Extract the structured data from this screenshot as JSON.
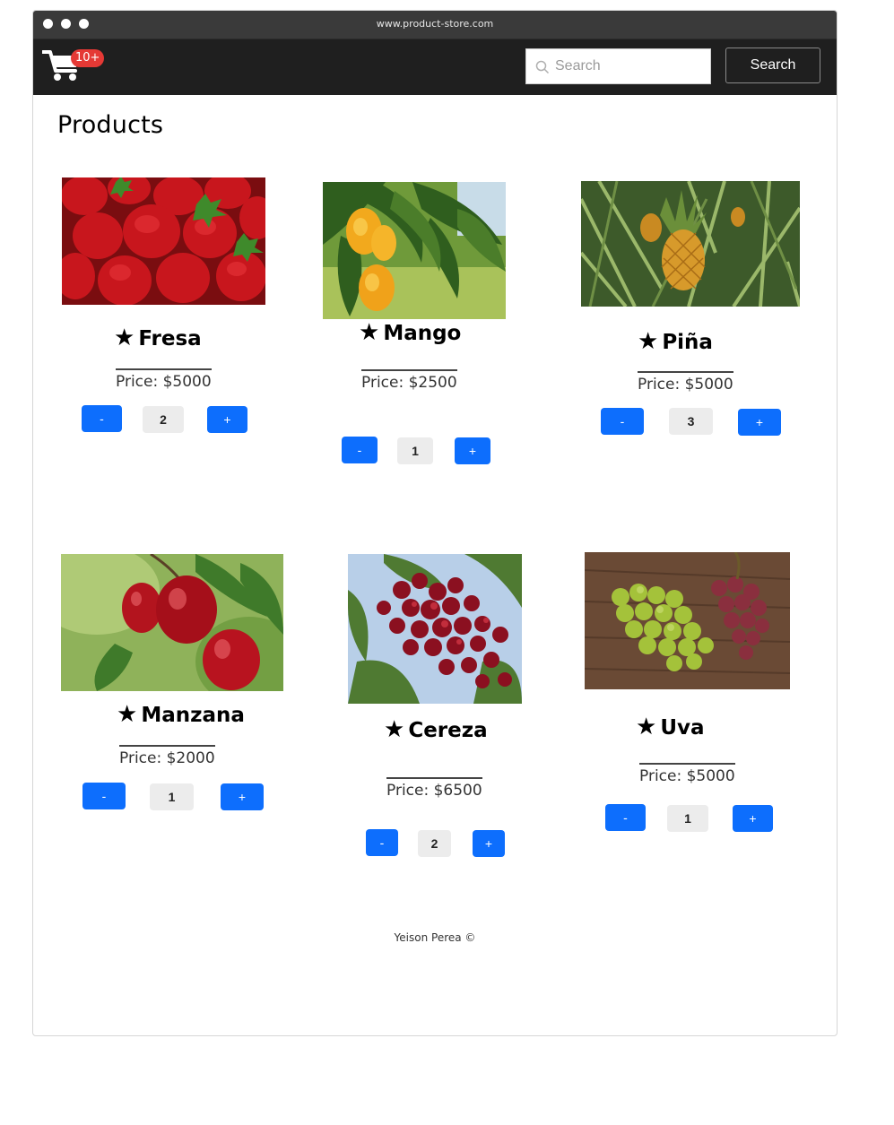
{
  "browser": {
    "url": "www.product-store.com"
  },
  "navbar": {
    "cart_badge": "10+",
    "search_placeholder": "Search",
    "search_button": "Search"
  },
  "page": {
    "title": "Products"
  },
  "products": [
    {
      "name": "Fresa",
      "price": "Price: $5000",
      "qty": "2",
      "minus": "-",
      "plus": "+",
      "image": "strawberries"
    },
    {
      "name": "Mango",
      "price": "Price: $2500",
      "qty": "1",
      "minus": "-",
      "plus": "+",
      "image": "mangoes"
    },
    {
      "name": "Piña",
      "price": "Price: $5000",
      "qty": "3",
      "minus": "-",
      "plus": "+",
      "image": "pineapple"
    },
    {
      "name": "Manzana",
      "price": "Price: $2000",
      "qty": "1",
      "minus": "-",
      "plus": "+",
      "image": "apples"
    },
    {
      "name": "Cereza",
      "price": "Price: $6500",
      "qty": "2",
      "minus": "-",
      "plus": "+",
      "image": "cherries"
    },
    {
      "name": "Uva",
      "price": "Price: $5000",
      "qty": "1",
      "minus": "-",
      "plus": "+",
      "image": "grapes"
    }
  ],
  "footer": {
    "text": "Yeison Perea ©"
  },
  "colors": {
    "navbar": "#1f1f1f",
    "button": "#0d6efd",
    "badge": "#e53935"
  },
  "icons": {
    "cart": "shopping-cart-icon",
    "star": "star-icon",
    "search": "search-icon"
  }
}
